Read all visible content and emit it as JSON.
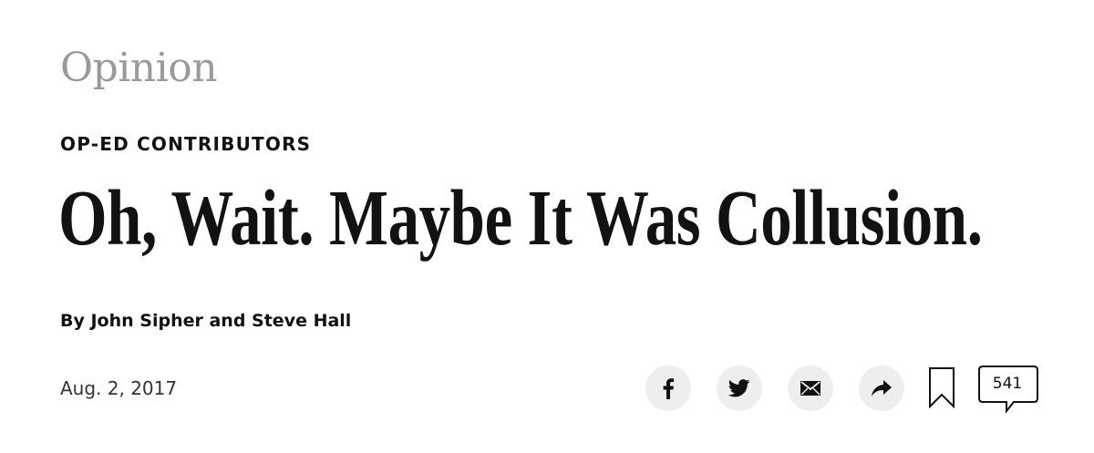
{
  "section": {
    "label": "Opinion"
  },
  "article": {
    "kicker": "OP-ED CONTRIBUTORS",
    "headline": "Oh, Wait. Maybe It Was Collusion.",
    "byline": "By John Sipher and Steve Hall",
    "date": "Aug. 2, 2017"
  },
  "share_tools": {
    "buttons": [
      {
        "icon": "facebook-icon"
      },
      {
        "icon": "twitter-icon"
      },
      {
        "icon": "email-icon"
      },
      {
        "icon": "share-arrow-icon"
      }
    ],
    "save_icon": "bookmark-icon",
    "comment_count": "541"
  },
  "colors": {
    "text": "#121212",
    "section_label": "#9a9a9a",
    "button_bg": "#eeeeee"
  }
}
